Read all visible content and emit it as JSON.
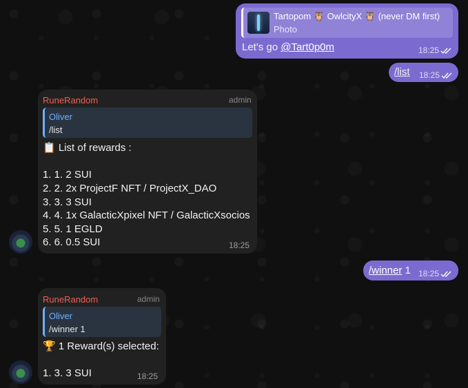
{
  "messages": {
    "m1": {
      "reply_title": "Tartopom 🦉 OwlcityX 🦉 (never DM first)",
      "reply_subtitle": "Photo",
      "text_prefix": "Let's go ",
      "mention": "@Tart0p0m",
      "time": "18:25"
    },
    "m2": {
      "text": "/list",
      "time": "18:25"
    },
    "m3": {
      "sender": "RuneRandom",
      "role": "admin",
      "quote_name": "Oliver",
      "quote_text": "/list",
      "lines": [
        "📋 List of rewards :",
        "1. 1. 2 SUI",
        "2. 2. 2x ProjectF NFT / ProjectX_DAO",
        "3. 3. 3 SUI",
        "4. 4. 1x GalacticXpixel NFT / GalacticXsocios",
        "5. 5. 1 EGLD",
        "6. 6. 0.5 SUI"
      ],
      "time": "18:25"
    },
    "m4": {
      "command": "/winner",
      "arg": " 1",
      "time": "18:25"
    },
    "m5": {
      "sender": "RuneRandom",
      "role": "admin",
      "quote_name": "Oliver",
      "quote_text": "/winner 1",
      "lines": [
        "🏆 1 Reward(s) selected:",
        "1. 3. 3 SUI"
      ],
      "time": "18:25"
    }
  },
  "icons": {
    "read_receipt": "double-check-icon",
    "avatar": "bot-avatar",
    "reply_thumb": "photo-thumbnail"
  },
  "colors": {
    "outgoing_bubble": "#7b6bd0",
    "incoming_bubble": "#212121",
    "sender_name": "#f25f55",
    "quote_accent": "#6fb1ff"
  }
}
